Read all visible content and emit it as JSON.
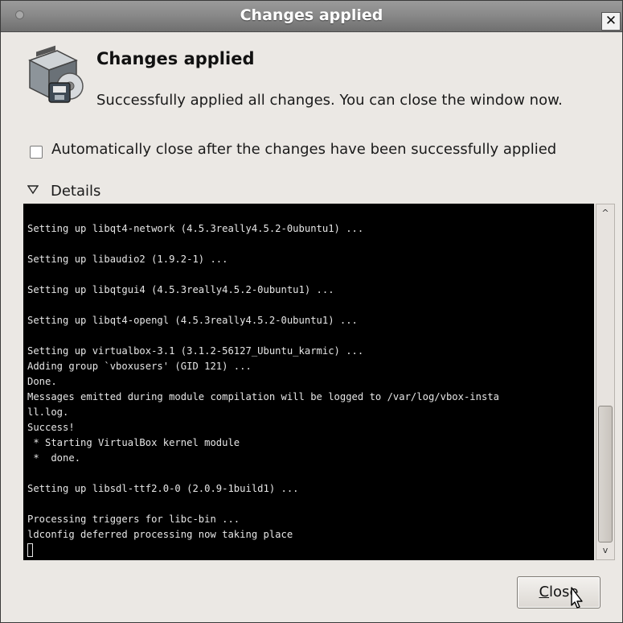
{
  "window": {
    "title": "Changes applied",
    "close_glyph": "✕"
  },
  "header": {
    "icon": "package-install-icon",
    "title": "Changes applied",
    "description": "Successfully applied all changes. You can close the window now."
  },
  "auto_close": {
    "label": "Automatically close after the changes have been successfully applied",
    "checked": false
  },
  "details": {
    "label": "Details",
    "expanded": true
  },
  "terminal": {
    "lines": [
      "Setting up libqt4-network (4.5.3really4.5.2-0ubuntu1) ...",
      "",
      "Setting up libaudio2 (1.9.2-1) ...",
      "",
      "Setting up libqtgui4 (4.5.3really4.5.2-0ubuntu1) ...",
      "",
      "Setting up libqt4-opengl (4.5.3really4.5.2-0ubuntu1) ...",
      "",
      "Setting up virtualbox-3.1 (3.1.2-56127_Ubuntu_karmic) ...",
      "Adding group `vboxusers' (GID 121) ...",
      "Done.",
      "Messages emitted during module compilation will be logged to /var/log/vbox-insta",
      "ll.log.",
      "Success!",
      " * Starting VirtualBox kernel module",
      " *  done.",
      "",
      "Setting up libsdl-ttf2.0-0 (2.0.9-1build1) ...",
      "",
      "Processing triggers for libc-bin ...",
      "ldconfig deferred processing now taking place"
    ]
  },
  "scrollbar": {
    "up_glyph": "^",
    "down_glyph": "v"
  },
  "footer": {
    "close_button_mnemonic": "C",
    "close_button_rest": "lose"
  },
  "colors": {
    "terminal_bg": "#000000",
    "terminal_fg": "#e6e6e6",
    "window_bg": "#ebe8e4"
  }
}
